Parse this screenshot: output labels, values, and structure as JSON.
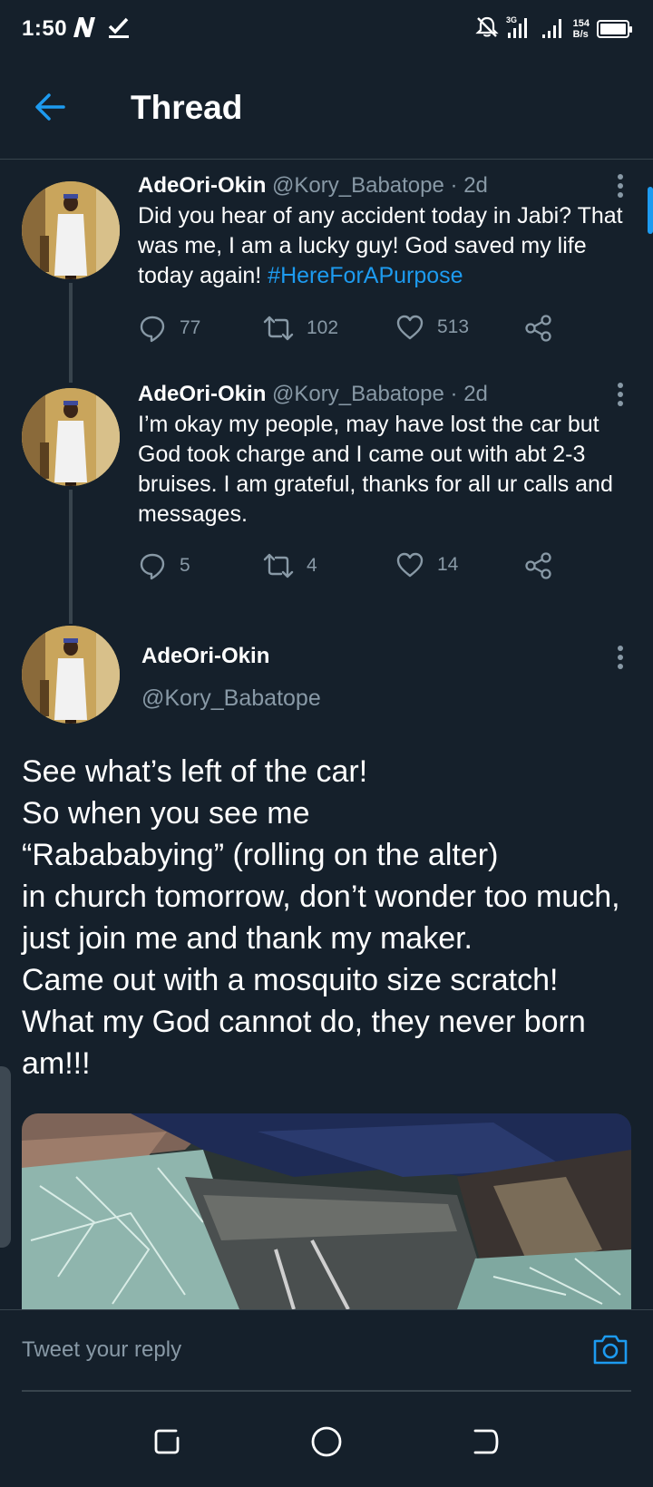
{
  "status_bar": {
    "time": "1:50",
    "net_speed_value": "154",
    "net_speed_unit": "B/s",
    "icons": [
      "network-n-icon",
      "check-icon",
      "mute-icon",
      "signal-3g-icon",
      "signal-icon",
      "battery-icon"
    ]
  },
  "header": {
    "title": "Thread",
    "back_icon": "back-arrow-icon"
  },
  "colors": {
    "background": "#15202b",
    "accent": "#1d9bf0",
    "secondary_text": "#8899a6",
    "divider": "#38444d"
  },
  "tweets": [
    {
      "name": "AdeOri-Okin",
      "handle": "@Kory_Babatope",
      "time": "· 2d",
      "text": "Did you hear of any accident today in Jabi? That was me, I am a lucky guy! God saved my life today  again! ",
      "hashtag": "#HereForAPurpose",
      "replies": "77",
      "retweets": "102",
      "likes": "513"
    },
    {
      "name": "AdeOri-Okin",
      "handle": "@Kory_Babatope",
      "time": "· 2d",
      "text": "I’m okay my people, may have lost the car but God took charge and I came out with abt 2-3 bruises. I am grateful, thanks for all ur calls and messages.",
      "replies": "5",
      "retweets": "4",
      "likes": "14"
    }
  ],
  "main_tweet": {
    "name": "AdeOri-Okin",
    "handle": "@Kory_Babatope",
    "text": "See what’s left of the car!\nSo when you see me\n“Rabababying” (rolling on the alter)\nin church tomorrow, don’t wonder too much, just join me and thank my maker.\nCame out with a mosquito size scratch!\nWhat my God cannot do, they never born am!!!"
  },
  "reply": {
    "placeholder": "Tweet your reply"
  }
}
